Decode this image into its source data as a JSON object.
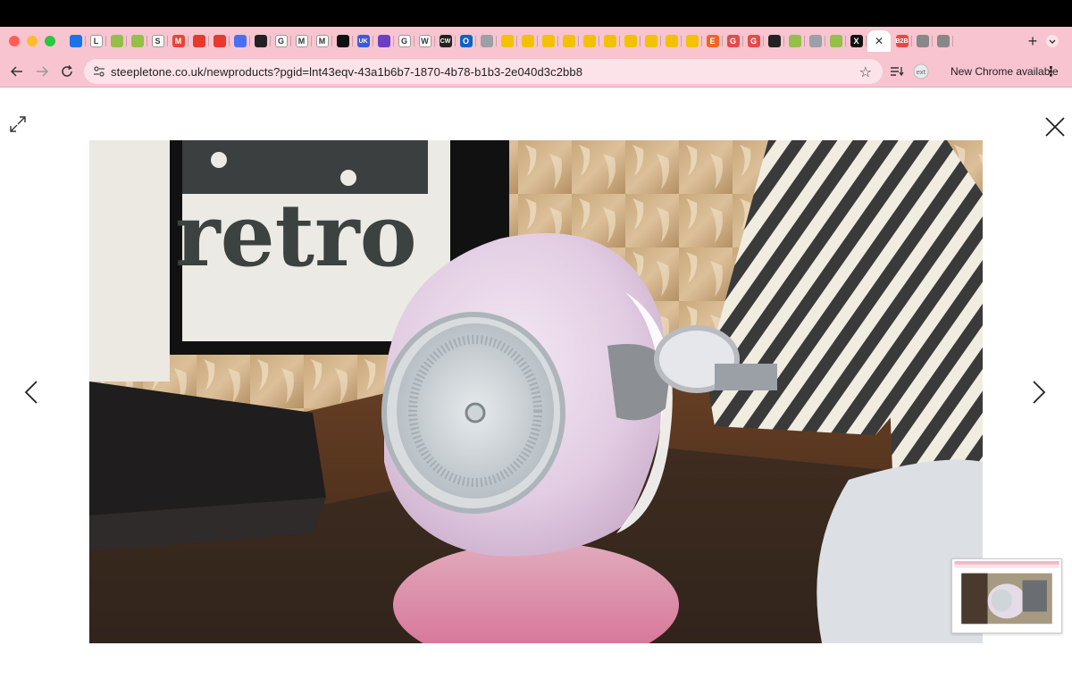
{
  "window": {
    "traffic_colors": [
      "#ff5f57",
      "#febc2e",
      "#28c840"
    ]
  },
  "tabs": [
    {
      "icon": "check-icon",
      "letter": "",
      "color": "#1a73e8"
    },
    {
      "icon": "l-icon",
      "letter": "L",
      "color": "#ffffff"
    },
    {
      "icon": "shopify-icon",
      "letter": "",
      "color": "#95bf47"
    },
    {
      "icon": "shopify-icon",
      "letter": "",
      "color": "#95bf47"
    },
    {
      "icon": "s-icon",
      "letter": "S",
      "color": "#ffffff"
    },
    {
      "icon": "gmail-icon",
      "letter": "M",
      "color": "#ea4335"
    },
    {
      "icon": "wp-icon",
      "letter": "",
      "color": "#e8392c"
    },
    {
      "icon": "wp-icon",
      "letter": "",
      "color": "#e8392c"
    },
    {
      "icon": "bird-icon",
      "letter": "",
      "color": "#4c6ef5"
    },
    {
      "icon": "shopify-bag-icon",
      "letter": "",
      "color": "#222222"
    },
    {
      "icon": "google-icon",
      "letter": "G",
      "color": "#ffffff"
    },
    {
      "icon": "m-icon",
      "letter": "M",
      "color": "#ffffff"
    },
    {
      "icon": "m-icon",
      "letter": "M",
      "color": "#ffffff"
    },
    {
      "icon": "tiktok-icon",
      "letter": "",
      "color": "#111111"
    },
    {
      "icon": "uk-icon",
      "letter": "UK",
      "color": "#3b5bdb"
    },
    {
      "icon": "crosshair-icon",
      "letter": "",
      "color": "#6c3fc5"
    },
    {
      "icon": "google-icon",
      "letter": "G",
      "color": "#ffffff"
    },
    {
      "icon": "w-icon",
      "letter": "W",
      "color": "#ffffff"
    },
    {
      "icon": "cw-icon",
      "letter": "CW",
      "color": "#222222"
    },
    {
      "icon": "outlook-icon",
      "letter": "O",
      "color": "#0a64c8"
    },
    {
      "icon": "extension-icon",
      "letter": "",
      "color": "#9aa0a6"
    },
    {
      "icon": "star-logo-icon",
      "letter": "",
      "color": "#f2c200"
    },
    {
      "icon": "star-logo-icon",
      "letter": "",
      "color": "#f2c200"
    },
    {
      "icon": "star-logo-icon",
      "letter": "",
      "color": "#f2c200"
    },
    {
      "icon": "star-logo-icon",
      "letter": "",
      "color": "#f2c200"
    },
    {
      "icon": "star-logo-icon",
      "letter": "",
      "color": "#f2c200"
    },
    {
      "icon": "star-logo-icon",
      "letter": "",
      "color": "#f2c200"
    },
    {
      "icon": "star-logo-icon",
      "letter": "",
      "color": "#f2c200"
    },
    {
      "icon": "star-logo-icon",
      "letter": "",
      "color": "#f2c200"
    },
    {
      "icon": "star-logo-icon",
      "letter": "",
      "color": "#f2c200"
    },
    {
      "icon": "star-logo-icon",
      "letter": "",
      "color": "#f2c200"
    },
    {
      "icon": "etsy-icon",
      "letter": "E",
      "color": "#f16521"
    },
    {
      "icon": "g-red-icon",
      "letter": "G",
      "color": "#e34b4b"
    },
    {
      "icon": "g-red-icon",
      "letter": "G",
      "color": "#e34b4b"
    },
    {
      "icon": "shopify-bag-icon",
      "letter": "",
      "color": "#222222"
    },
    {
      "icon": "shopify-icon",
      "letter": "",
      "color": "#95bf47"
    },
    {
      "icon": "extension-icon",
      "letter": "",
      "color": "#9aa0a6"
    },
    {
      "icon": "shopify-icon",
      "letter": "",
      "color": "#95bf47"
    },
    {
      "icon": "x-logo-icon",
      "letter": "X",
      "color": "#111111"
    }
  ],
  "tab_extra": [
    {
      "icon": "b2b-icon",
      "letter": "B2B",
      "color": "#e34b4b"
    },
    {
      "icon": "apple-icon",
      "letter": "",
      "color": "#888888"
    },
    {
      "icon": "apple-icon",
      "letter": "",
      "color": "#888888"
    }
  ],
  "toolbar": {
    "url": "steepletone.co.uk/newproducts?pgid=lnt43eqv-43a1b6b7-1870-4b78-b1b3-2e040d3c2bb8",
    "update_label": "New Chrome available",
    "update_menu": "⋮"
  },
  "photo": {
    "poster_text": "retro"
  }
}
